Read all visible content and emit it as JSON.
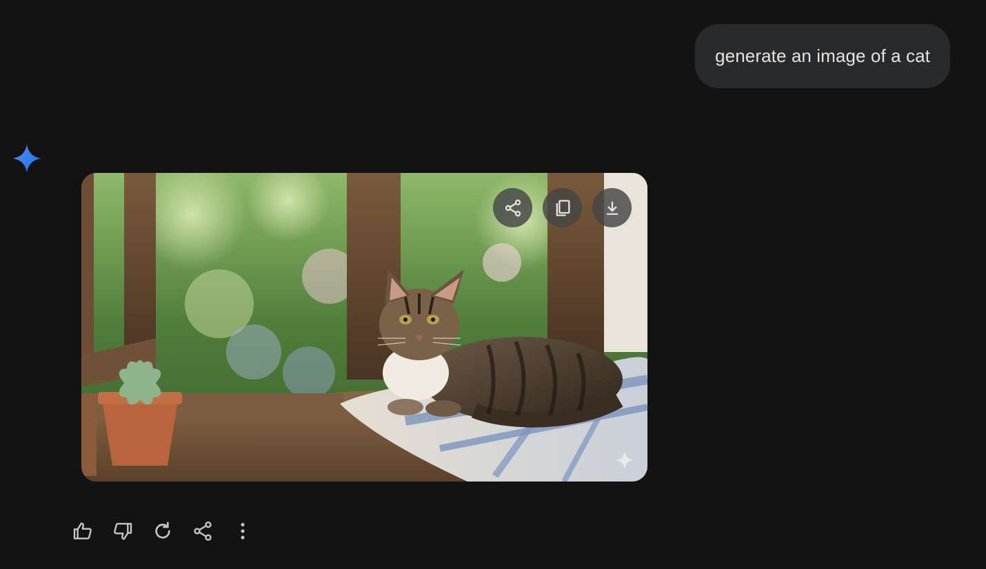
{
  "conversation": {
    "user_message": "generate an image of a cat"
  },
  "response": {
    "image": {
      "subject": "cat",
      "overlay_buttons": [
        {
          "name": "share-icon"
        },
        {
          "name": "copy-icon"
        },
        {
          "name": "download-icon"
        }
      ],
      "watermark_icon": "sparkle-icon"
    },
    "actions": [
      {
        "name": "thumbs-up-icon"
      },
      {
        "name": "thumbs-down-icon"
      },
      {
        "name": "regenerate-icon"
      },
      {
        "name": "share-icon"
      },
      {
        "name": "more-options-icon"
      }
    ]
  },
  "colors": {
    "background": "#131314",
    "bubble": "#282a2c",
    "text": "#e3e3e3",
    "icon": "#c4c7c5",
    "accent_gradient_start": "#4285f4",
    "accent_gradient_end": "#1a73e8"
  }
}
